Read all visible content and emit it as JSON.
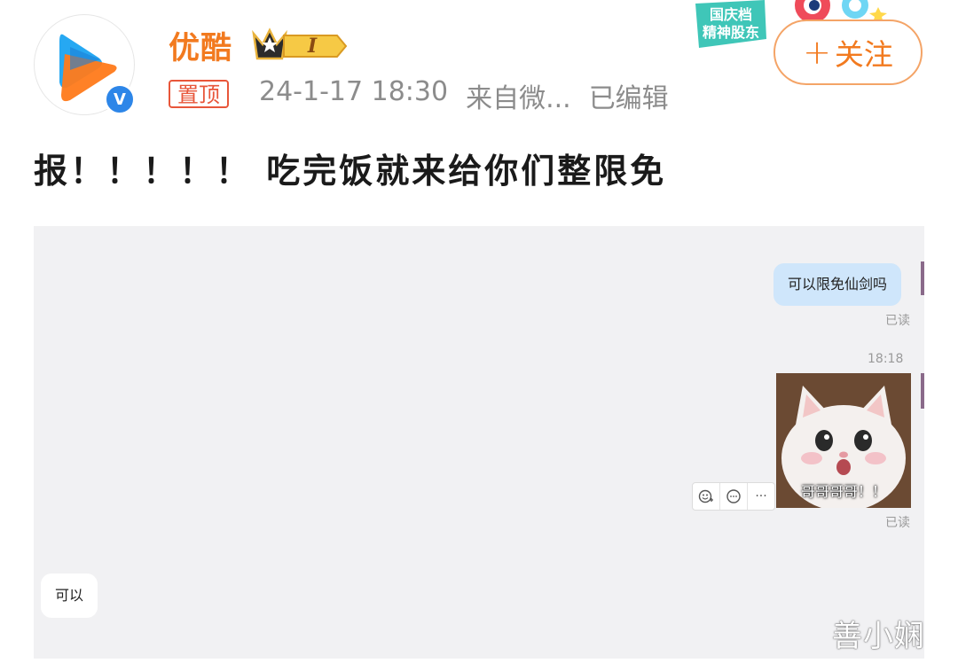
{
  "post": {
    "username": "优酷",
    "vip_level": "I",
    "pin_label": "置顶",
    "timestamp": "24-1-17 18:30",
    "source": "来自微...",
    "edited": "已编辑",
    "follow_label": "关注",
    "follow_icon": "plus-icon",
    "promo_line1": "国庆档",
    "promo_line2": "精神股东",
    "text": "报！！！！！ 吃完饭就来给你们整限免"
  },
  "chat": {
    "messages": [
      {
        "direction": "out",
        "text": "可以限免仙剑吗",
        "status": "已读"
      },
      {
        "direction": "out",
        "time": "18:18",
        "sticker_caption": "哥哥哥哥！！",
        "status": "已读"
      },
      {
        "direction": "in",
        "text": "可以"
      }
    ],
    "message_actions": [
      "emoji-reaction-icon",
      "comment-icon",
      "more-icon"
    ]
  },
  "watermark": "善小娴",
  "colors": {
    "brand_orange": "#f27a1f",
    "verified_blue": "#2d86e8",
    "pin_red": "#e8563a",
    "outgoing_bubble": "#cfe6fb",
    "chat_background": "#f1f1f3"
  }
}
